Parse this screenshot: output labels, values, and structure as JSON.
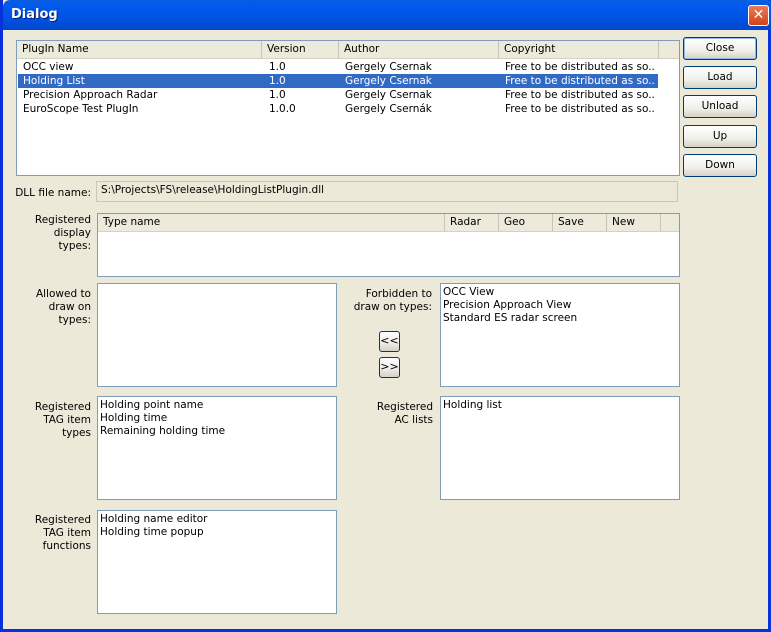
{
  "window": {
    "title": "Dialog",
    "close_glyph": "✕"
  },
  "plugins": {
    "columns": [
      "PlugIn Name",
      "Version",
      "Author",
      "Copyright"
    ],
    "rows": [
      [
        "OCC view",
        "1.0",
        "Gergely Csernak",
        "Free to be distributed as so..."
      ],
      [
        "Holding List",
        "1.0",
        "Gergely Csernak",
        "Free to be distributed as so..."
      ],
      [
        "Precision Approach Radar",
        "1.0",
        "Gergely Csernak",
        "Free to be distributed as so..."
      ],
      [
        "EuroScope Test PlugIn",
        "1.0.0",
        "Gergely Csernák",
        "Free to be distributed as so..."
      ]
    ],
    "selected_row": 1
  },
  "buttons": {
    "close": "Close",
    "load": "Load",
    "unload": "Unload",
    "up": "Up",
    "down": "Down"
  },
  "dll": {
    "label": "DLL file name:",
    "value": "S:\\Projects\\FS\\release\\HoldingListPlugin.dll"
  },
  "display_types": {
    "label": "Registered display types:",
    "columns": [
      "Type name",
      "Radar",
      "Geo",
      "Save",
      "New"
    ]
  },
  "allowed": {
    "label": "Allowed to draw on types:",
    "items": []
  },
  "forbidden": {
    "label": "Forbidden to draw on types:",
    "items": [
      "OCC View",
      "Precision Approach View",
      "Standard ES radar screen"
    ]
  },
  "move_buttons": {
    "left": "<<",
    "right": ">>"
  },
  "tag_item_types": {
    "label": "Registered TAG item types",
    "items": [
      "Holding point name",
      "Holding time",
      "Remaining holding time"
    ]
  },
  "ac_lists": {
    "label": "Registered AC lists",
    "items": [
      "Holding list"
    ]
  },
  "tag_item_functions": {
    "label": "Registered TAG item functions",
    "items": [
      "Holding name editor",
      "Holding time popup"
    ]
  },
  "colors": {
    "selection": "#316ac5",
    "titlebar": "#0054e3",
    "face": "#ece9d8"
  }
}
